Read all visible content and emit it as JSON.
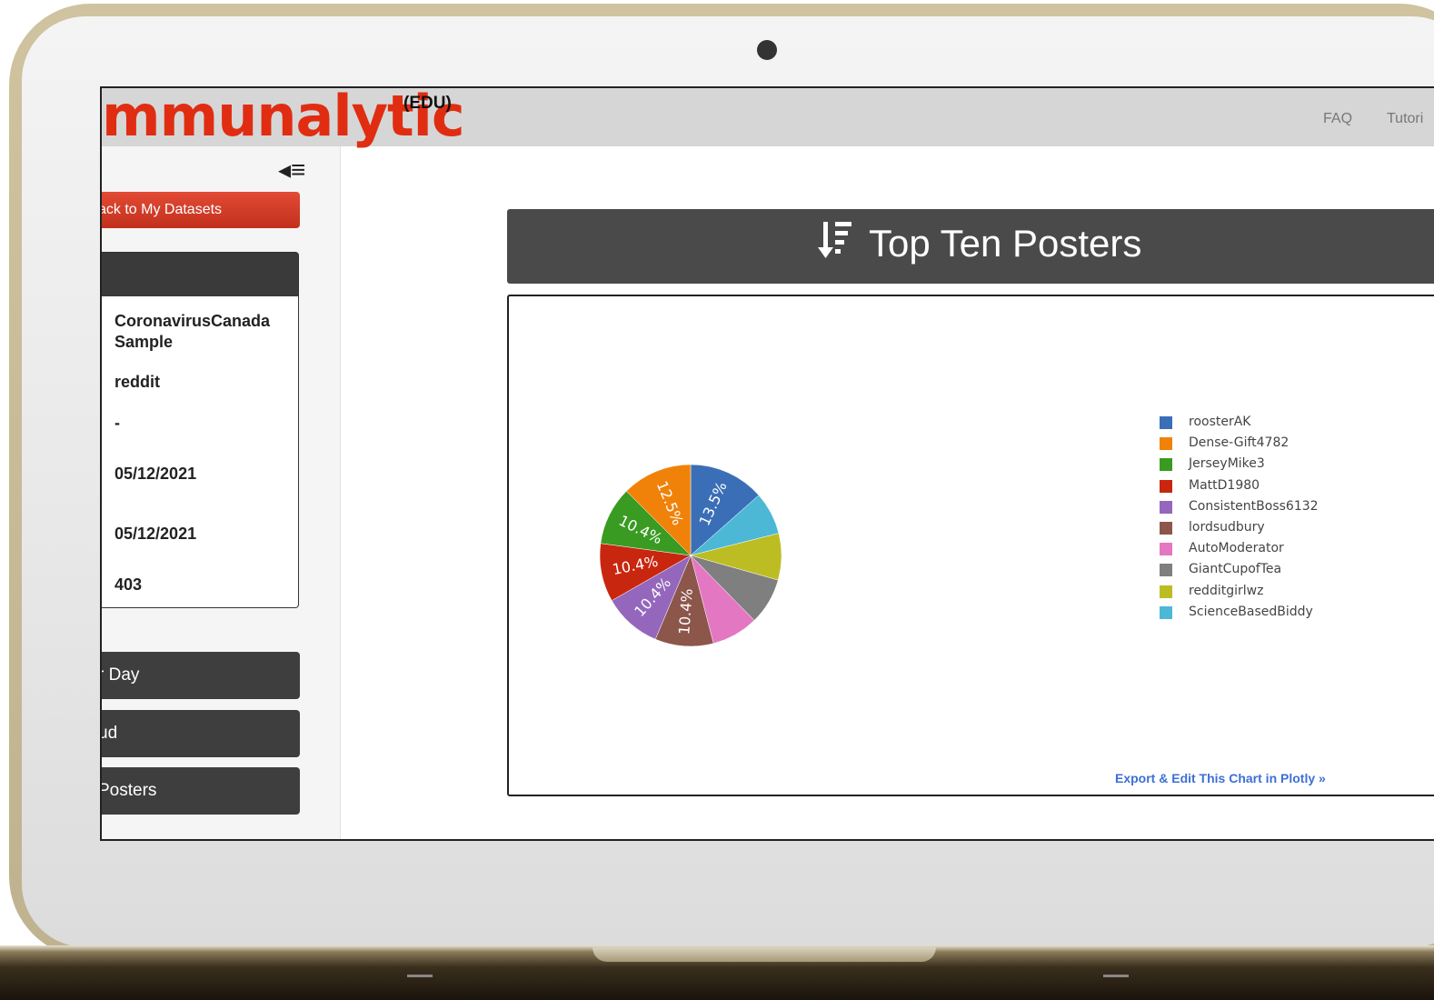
{
  "app": {
    "logo_text": "mmunalytic",
    "edition": "(EDU)"
  },
  "nav": {
    "faq": "FAQ",
    "tutorials": "Tutori"
  },
  "sidebar": {
    "back_label": "ack to My Datasets",
    "dataset": {
      "name": "CoronavirusCanada Sample",
      "source": "reddit",
      "extra": "-",
      "start_date": "05/12/2021",
      "end_date": "05/12/2021",
      "count": "403"
    },
    "buttons": [
      "r Day",
      "ud",
      "Posters"
    ]
  },
  "panel": {
    "title": "Top Ten Posters",
    "export_link": "Export & Edit This Chart in Plotly »"
  },
  "chart_data": {
    "type": "pie",
    "labels": [
      "roosterAK",
      "Dense-Gift4782",
      "JerseyMike3",
      "MattD1980",
      "ConsistentBoss6132",
      "lordsudbury",
      "AutoModerator",
      "GiantCupofTea",
      "redditgirlwz",
      "ScienceBasedBiddy"
    ],
    "pie_order": [
      "roosterAK",
      "ScienceBasedBiddy",
      "redditgirlwz",
      "GiantCupofTea",
      "AutoModerator",
      "lordsudbury",
      "ConsistentBoss6132",
      "MattD1980",
      "JerseyMike3",
      "Dense-Gift4782"
    ],
    "values": [
      13.5,
      12.5,
      10.4,
      10.4,
      10.4,
      10.4,
      8.3,
      8.3,
      8.3,
      7.6
    ],
    "labels_shown": [
      "13.5%",
      "12.5%",
      "10.4%",
      "10.4%",
      "10.4%",
      "10.4%",
      "",
      "",
      "",
      ""
    ],
    "colors": [
      "#3a6fb7",
      "#f0820a",
      "#3a9b22",
      "#c9260f",
      "#9467bd",
      "#8c564b",
      "#e377c2",
      "#7f7f7f",
      "#bcbd22",
      "#4db8d6"
    ],
    "legend_position": "right"
  }
}
